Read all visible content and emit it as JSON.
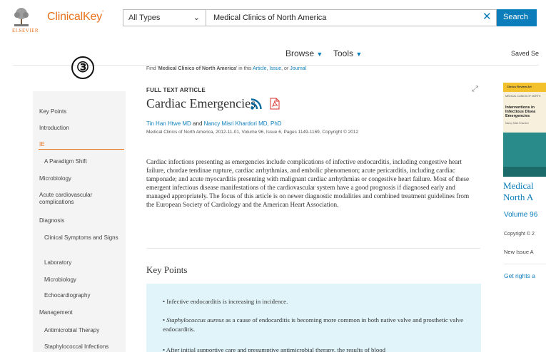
{
  "header": {
    "logo_text": "ClinicalKey",
    "logo_tm": "°",
    "publisher": "ELSEVIER",
    "type_select": "All Types",
    "search_value": "Medical Clinics of North America",
    "search_button": "Search",
    "clear_glyph": "✕"
  },
  "nav": {
    "browse": "Browse",
    "tools": "Tools",
    "saved": "Saved Se"
  },
  "annotation": "③",
  "find_line": {
    "prefix": "Find '",
    "bold": "Medical Clinics of North America",
    "mid": "' in this ",
    "article": "Article",
    "issue": "Issue",
    "or": ", or ",
    "journal": "Journal"
  },
  "article": {
    "label": "FULL TEXT ARTICLE",
    "title": "Cardiac Emergencies",
    "author1": "Tin Han Htwe MD",
    "and": " and ",
    "author2": "Nancy Misri Khardori MD, PhD",
    "citation": "Medical Clinics of North America, 2012-11-01, Volume 96, Issue 6, Pages 1149-1169, Copyright © 2012",
    "abstract": "Cardiac infections presenting as emergencies include complications of infective endocarditis, including congestive heart failure, chordae tendinae rupture, cardiac arrhythmias, and embolic phenomenon; acute pericarditis, including cardiac tamponade; and acute myocarditis presenting with malignant cardiac arrhythmias or congestive heart failure. Most of these emergent infectious disease manifestations of the cardiovascular system have a good prognosis if diagnosed early and managed appropriately. The focus of this article is on newer diagnostic modalities and combined treatment guidelines from the European Society of Cardiology and the American Heart Association.",
    "key_points_heading": "Key Points",
    "key_points": [
      "• Infective endocarditis is increasing in incidence.",
      "• Staphylococcus aureus as a cause of endocarditis is becoming more common in both native valve and prosthetic valve endocarditis.",
      "• After initial supportive care and presumptive antimicrobial therapy, the results of blood"
    ]
  },
  "sidebar": {
    "items": [
      {
        "label": "Key Points",
        "active": false
      },
      {
        "label": "Introduction",
        "active": false
      },
      {
        "label": "IE",
        "active": true
      },
      {
        "label": "A Paradigm Shift",
        "active": false
      },
      {
        "label": "Microbiology",
        "active": false
      },
      {
        "label": "Acute cardiovascular complications",
        "active": false
      },
      {
        "label": "Diagnosis",
        "active": false
      },
      {
        "label": "Clinical Symptoms and Signs",
        "active": false
      },
      {
        "label": "Laboratory",
        "active": false
      },
      {
        "label": "Microbiology",
        "active": false
      },
      {
        "label": "Echocardiography",
        "active": false
      },
      {
        "label": "Management",
        "active": false
      },
      {
        "label": "Antimicrobial Therapy",
        "active": false
      },
      {
        "label": "Staphylococcal Infections",
        "active": false
      }
    ]
  },
  "right": {
    "cover_band": "Clinics Review Art",
    "cover_sub": "MEDICAL CLINICS OF NORTH",
    "cover_title": "Interventions in Infectious Disea Emergencies",
    "cover_small": "Nancy Misri Khardori",
    "journal_line1": "Medical",
    "journal_line2": "North A",
    "volume": "Volume 96",
    "copyright": "Copyright © 2",
    "new_issue": "New Issue A",
    "rights": "Get rights a"
  },
  "colors": {
    "accent": "#0c7dbb",
    "brand": "#e9711c",
    "key_points_bg": "#e0f4fa"
  }
}
